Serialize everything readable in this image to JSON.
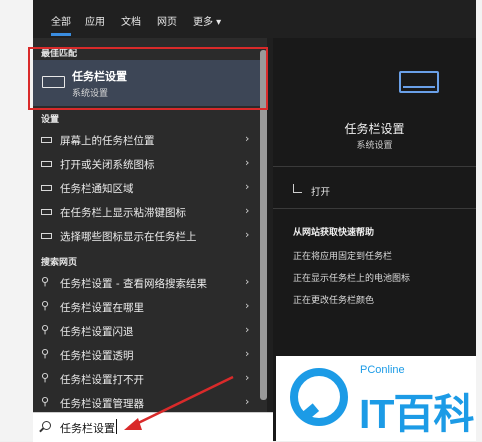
{
  "tabs": [
    "全部",
    "应用",
    "文档",
    "网页",
    "更多 ▾"
  ],
  "best_match": {
    "section_label": "最佳匹配",
    "title": "任务栏设置",
    "subtitle": "系统设置"
  },
  "settings": {
    "section_label": "设置",
    "items": [
      "屏幕上的任务栏位置",
      "打开或关闭系统图标",
      "任务栏通知区域",
      "在任务栏上显示粘滞键图标",
      "选择哪些图标显示在任务栏上"
    ]
  },
  "web": {
    "section_label": "搜索网页",
    "items": [
      "任务栏设置 - 查看网络搜索结果",
      "任务栏设置在哪里",
      "任务栏设置闪退",
      "任务栏设置透明",
      "任务栏设置打不开",
      "任务栏设置管理器"
    ]
  },
  "detail": {
    "title": "任务栏设置",
    "subtitle": "系统设置",
    "open_label": "打开",
    "help_header": "从网站获取快速帮助",
    "help_items": [
      "正在将应用固定到任务栏",
      "正在显示任务栏上的电池图标",
      "正在更改任务栏颜色"
    ]
  },
  "search": {
    "query": "任务栏设置"
  },
  "watermark": {
    "brand": "PConline",
    "text": "IT百科"
  },
  "colors": {
    "accent": "#3a8de0",
    "highlight": "#d92a2a",
    "selected_bg": "#3d4656",
    "watermark": "#1c9be6"
  }
}
